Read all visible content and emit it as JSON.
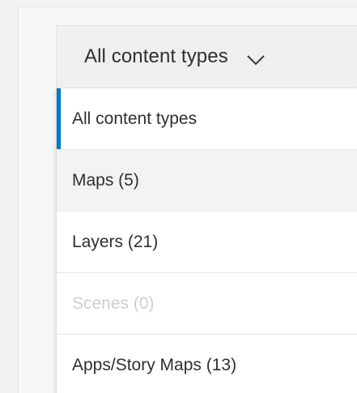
{
  "dropdown": {
    "selected_label": "All content types",
    "chevron_icon": "chevron-down-icon"
  },
  "menu": {
    "accent_color": "#0079c1",
    "items": [
      {
        "label": "All content types",
        "state": "selected"
      },
      {
        "label": "Maps (5)",
        "state": "hovered"
      },
      {
        "label": "Layers (21)",
        "state": "normal"
      },
      {
        "label": "Scenes (0)",
        "state": "disabled"
      },
      {
        "label": "Apps/Story Maps (13)",
        "state": "normal"
      }
    ]
  }
}
